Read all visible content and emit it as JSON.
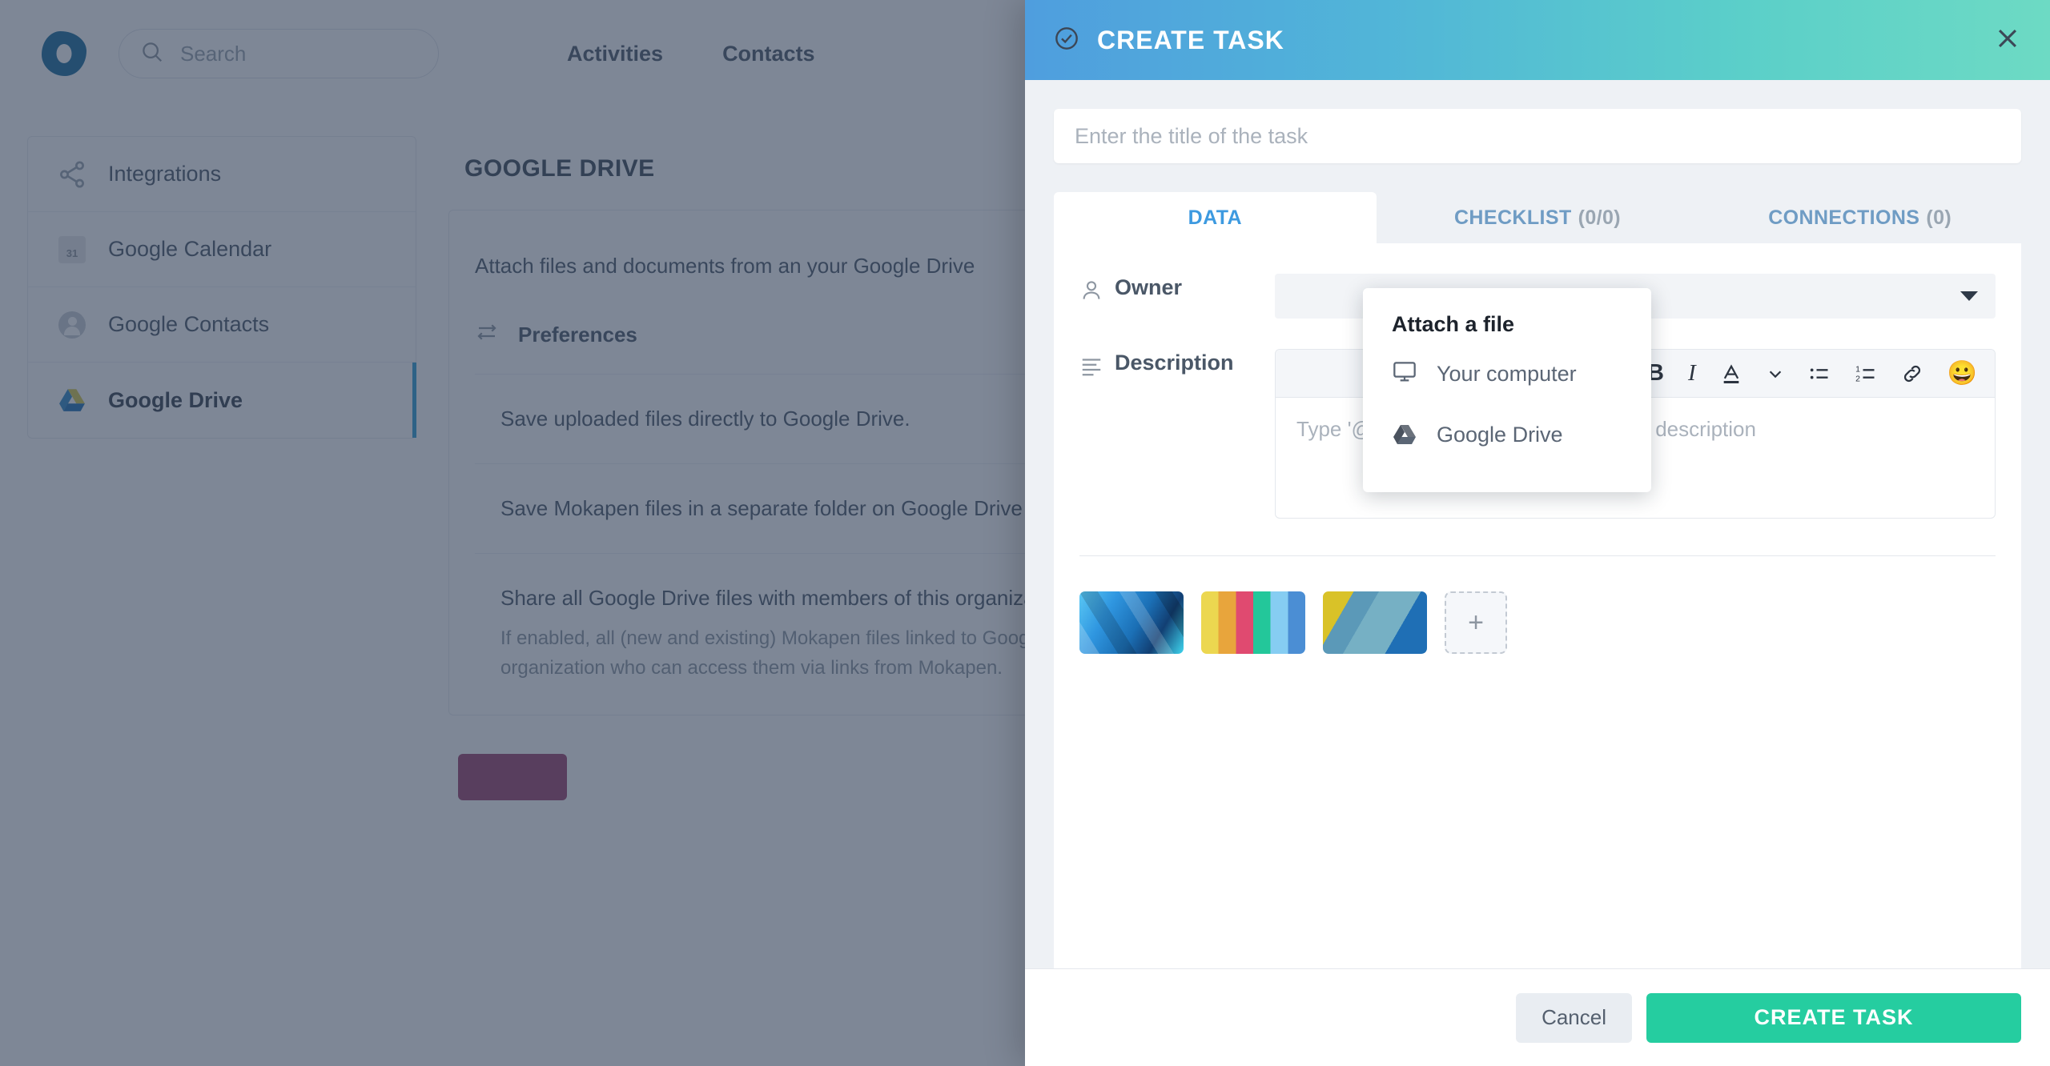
{
  "background": {
    "topbar": {
      "logo_name": "mokapen-logo",
      "search_placeholder": "Search",
      "nav_links": [
        "Activities",
        "Contacts"
      ]
    },
    "sidebar": {
      "items": [
        {
          "label": "Integrations",
          "icon": "share-nodes-icon",
          "active": false
        },
        {
          "label": "Google Calendar",
          "icon": "google-calendar-icon",
          "active": false
        },
        {
          "label": "Google Contacts",
          "icon": "google-contacts-icon",
          "active": false
        },
        {
          "label": "Google Drive",
          "icon": "google-drive-icon",
          "active": true
        }
      ]
    },
    "main": {
      "page_title": "GOOGLE DRIVE",
      "intro": "Attach files and documents from an your Google Drive",
      "preferences_heading": "Preferences",
      "preferences": [
        {
          "label": "Save uploaded files directly to Google Drive.",
          "sub": ""
        },
        {
          "label": "Save Mokapen files in a separate folder on Google Drive",
          "sub": ""
        },
        {
          "label": "Share all Google Drive files with members of this organization",
          "sub": "If enabled, all (new and existing) Mokapen files linked to Google Drive with all members of this organization who can access them via links from Mokapen."
        }
      ]
    }
  },
  "modal": {
    "header": {
      "title": "CREATE TASK",
      "check_icon": "check-circle-icon",
      "close_icon": "close-icon"
    },
    "title_input": {
      "value": "",
      "placeholder": "Enter the title of the task"
    },
    "tabs": [
      {
        "label": "DATA",
        "count": "",
        "active": true
      },
      {
        "label": "CHECKLIST",
        "count": "(0/0)",
        "active": false
      },
      {
        "label": "CONNECTIONS",
        "count": "(0)",
        "active": false
      }
    ],
    "fields": {
      "owner": {
        "label": "Owner",
        "icon": "user-icon",
        "value": "",
        "caret_icon": "caret-down-icon"
      },
      "description": {
        "label": "Description",
        "icon": "text-lines-icon",
        "placeholder": "Type '@' to mention an user or enter a description",
        "toolbar": [
          {
            "name": "bold-icon",
            "glyph": "B"
          },
          {
            "name": "italic-icon",
            "glyph": "I"
          },
          {
            "name": "text-color-icon",
            "glyph": "A"
          },
          {
            "name": "chevron-down-icon",
            "glyph": ""
          },
          {
            "name": "bullet-list-icon",
            "glyph": ""
          },
          {
            "name": "numbered-list-icon",
            "glyph": ""
          },
          {
            "name": "link-icon",
            "glyph": ""
          },
          {
            "name": "emoji-icon",
            "glyph": "😀"
          }
        ]
      }
    },
    "attachments": {
      "thumbnails": [
        {
          "name": "attachment-thumbnail-blue-abstract"
        },
        {
          "name": "attachment-thumbnail-color-palette"
        },
        {
          "name": "attachment-thumbnail-yellow-blue-stripes"
        }
      ],
      "add_label": "+"
    },
    "footer": {
      "cancel_label": "Cancel",
      "create_label": "CREATE TASK"
    },
    "attach_popup": {
      "title": "Attach a file",
      "items": [
        {
          "label": "Your computer",
          "icon": "monitor-icon"
        },
        {
          "label": "Google Drive",
          "icon": "google-drive-icon"
        }
      ]
    }
  },
  "colors": {
    "header_gradient_start": "#4f9ede",
    "header_gradient_end": "#6ddac4",
    "primary_action": "#25cda0",
    "active_tab_text": "#3d9ae0",
    "sidebar_active_bar": "#2f9fd4",
    "overlay": "rgba(47,62,86,0.62)"
  }
}
